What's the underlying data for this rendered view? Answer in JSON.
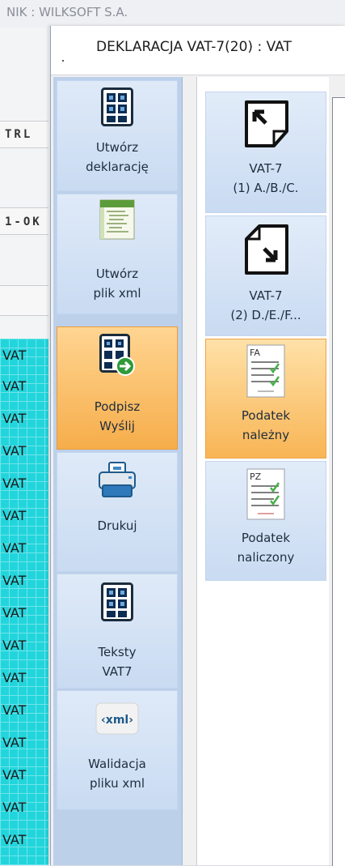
{
  "background": {
    "window_title": "NIK : WILKSOFT S.A.",
    "strip_labels": [
      "TRL",
      "1-OK"
    ],
    "grid_cells": [
      "VAT",
      "VAT",
      "VAT",
      "VAT",
      "VAT",
      "VAT",
      "VAT",
      "VAT",
      "VAT",
      "VAT",
      "VAT",
      "VAT",
      "VAT",
      "VAT",
      "VAT",
      "VAT"
    ],
    "grid_color": "#22d5dc"
  },
  "dialog": {
    "title": "DEKLARACJA VAT-7(20) : VAT"
  },
  "nav": {
    "items": [
      {
        "line1": "Utwórz",
        "line2": "deklarację",
        "icon": "form-grid-icon"
      },
      {
        "line1": "Utwórz",
        "line2": "plik xml",
        "icon": "xml-file-icon"
      },
      {
        "line1": "Podpisz",
        "line2": "Wyślij",
        "icon": "sign-send-icon",
        "active": true
      },
      {
        "line1": "Drukuj",
        "line2": "",
        "icon": "printer-icon"
      },
      {
        "line1": "Teksty",
        "line2": "VAT7",
        "icon": "form-grid-icon"
      },
      {
        "line1": "Walidacja",
        "line2": "pliku xml",
        "icon": "xml-tag-icon"
      }
    ]
  },
  "middle": {
    "items": [
      {
        "line1": "VAT-7",
        "line2": "(1) A./B./C.",
        "icon": "page-arrow-up-left-icon"
      },
      {
        "line1": "VAT-7",
        "line2": "(2) D./E./F...",
        "icon": "page-arrow-down-right-icon"
      },
      {
        "line1": "Podatek",
        "line2": "należny",
        "icon": "fa-document-icon",
        "badge": "FA",
        "active": true
      },
      {
        "line1": "Podatek",
        "line2": "naliczony",
        "icon": "pz-document-icon",
        "badge": "PZ"
      }
    ]
  },
  "colors": {
    "nav_bg": "#bcd0ea",
    "button_bg": "#cfdff4",
    "active_bg": "#f8b555"
  }
}
